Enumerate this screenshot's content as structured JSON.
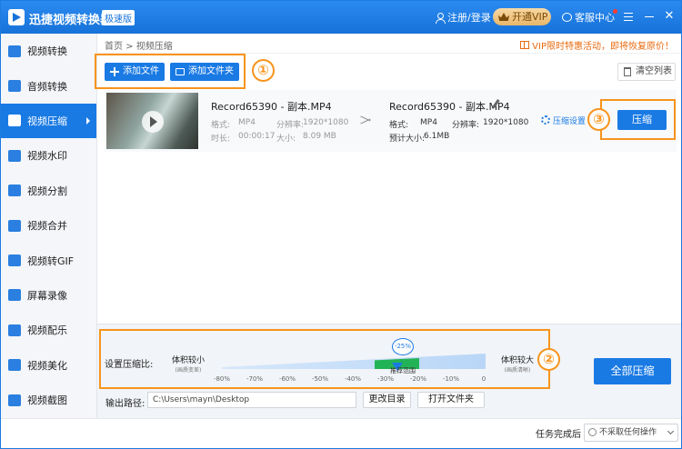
{
  "app": {
    "title": "迅捷视频转换器",
    "badge": "极速版",
    "login": "注册/登录",
    "vip": "开通VIP",
    "service": "客服中心"
  },
  "sidebar": {
    "items": [
      {
        "label": "视频转换",
        "icon": "video-convert-icon"
      },
      {
        "label": "音频转换",
        "icon": "audio-convert-icon"
      },
      {
        "label": "视频压缩",
        "icon": "video-compress-icon",
        "active": true
      },
      {
        "label": "视频水印",
        "icon": "watermark-icon"
      },
      {
        "label": "视频分割",
        "icon": "split-icon"
      },
      {
        "label": "视频合并",
        "icon": "merge-icon"
      },
      {
        "label": "视频转GIF",
        "icon": "gif-icon"
      },
      {
        "label": "屏幕录像",
        "icon": "screen-record-icon"
      },
      {
        "label": "视频配乐",
        "icon": "music-icon"
      },
      {
        "label": "视频美化",
        "icon": "beautify-icon"
      },
      {
        "label": "视频截图",
        "icon": "screenshot-icon"
      }
    ]
  },
  "breadcrumb": "首页 > 视频压缩",
  "promo": "VIP限时特惠活动，即将恢复原价！",
  "toolbar": {
    "add_file": "添加文件",
    "add_folder": "添加文件夹",
    "clear_list": "清空列表"
  },
  "annotations": {
    "one": "①",
    "two": "②",
    "three": "③"
  },
  "file": {
    "source": {
      "name": "Record65390 - 副本.MP4",
      "format_label": "格式:",
      "format": "MP4",
      "res_label": "分辨率:",
      "resolution": "1920*1080",
      "dur_label": "时长:",
      "duration": "00:00:17",
      "size_label": "大小:",
      "size": "8.09 MB"
    },
    "target": {
      "name": "Record65390 - 副本.MP4",
      "format_label": "格式:",
      "format": "MP4",
      "res_label": "分辨率:",
      "resolution": "1920*1080",
      "est_label": "预计大小:",
      "est_size": "6.1MB"
    },
    "settings": "压缩设置",
    "compress": "压缩"
  },
  "compression": {
    "label": "设置压缩比:",
    "small_label": "体积较小",
    "small_sub": "(画质变差)",
    "large_label": "体积较大",
    "large_sub": "(画质清晰)",
    "value": "-25%",
    "value_percent": -25,
    "recommend": "推荐范围",
    "ticks": [
      "-80%",
      "-70%",
      "-60%",
      "-50%",
      "-40%",
      "-30%",
      "-20%",
      "-10%",
      "0"
    ]
  },
  "compress_all": "全部压缩",
  "output": {
    "label": "输出路径:",
    "path": "C:\\Users\\mayn\\Desktop",
    "change_dir": "更改目录",
    "open_folder": "打开文件夹"
  },
  "status": {
    "label": "任务完成后",
    "option": "不采取任何操作"
  }
}
